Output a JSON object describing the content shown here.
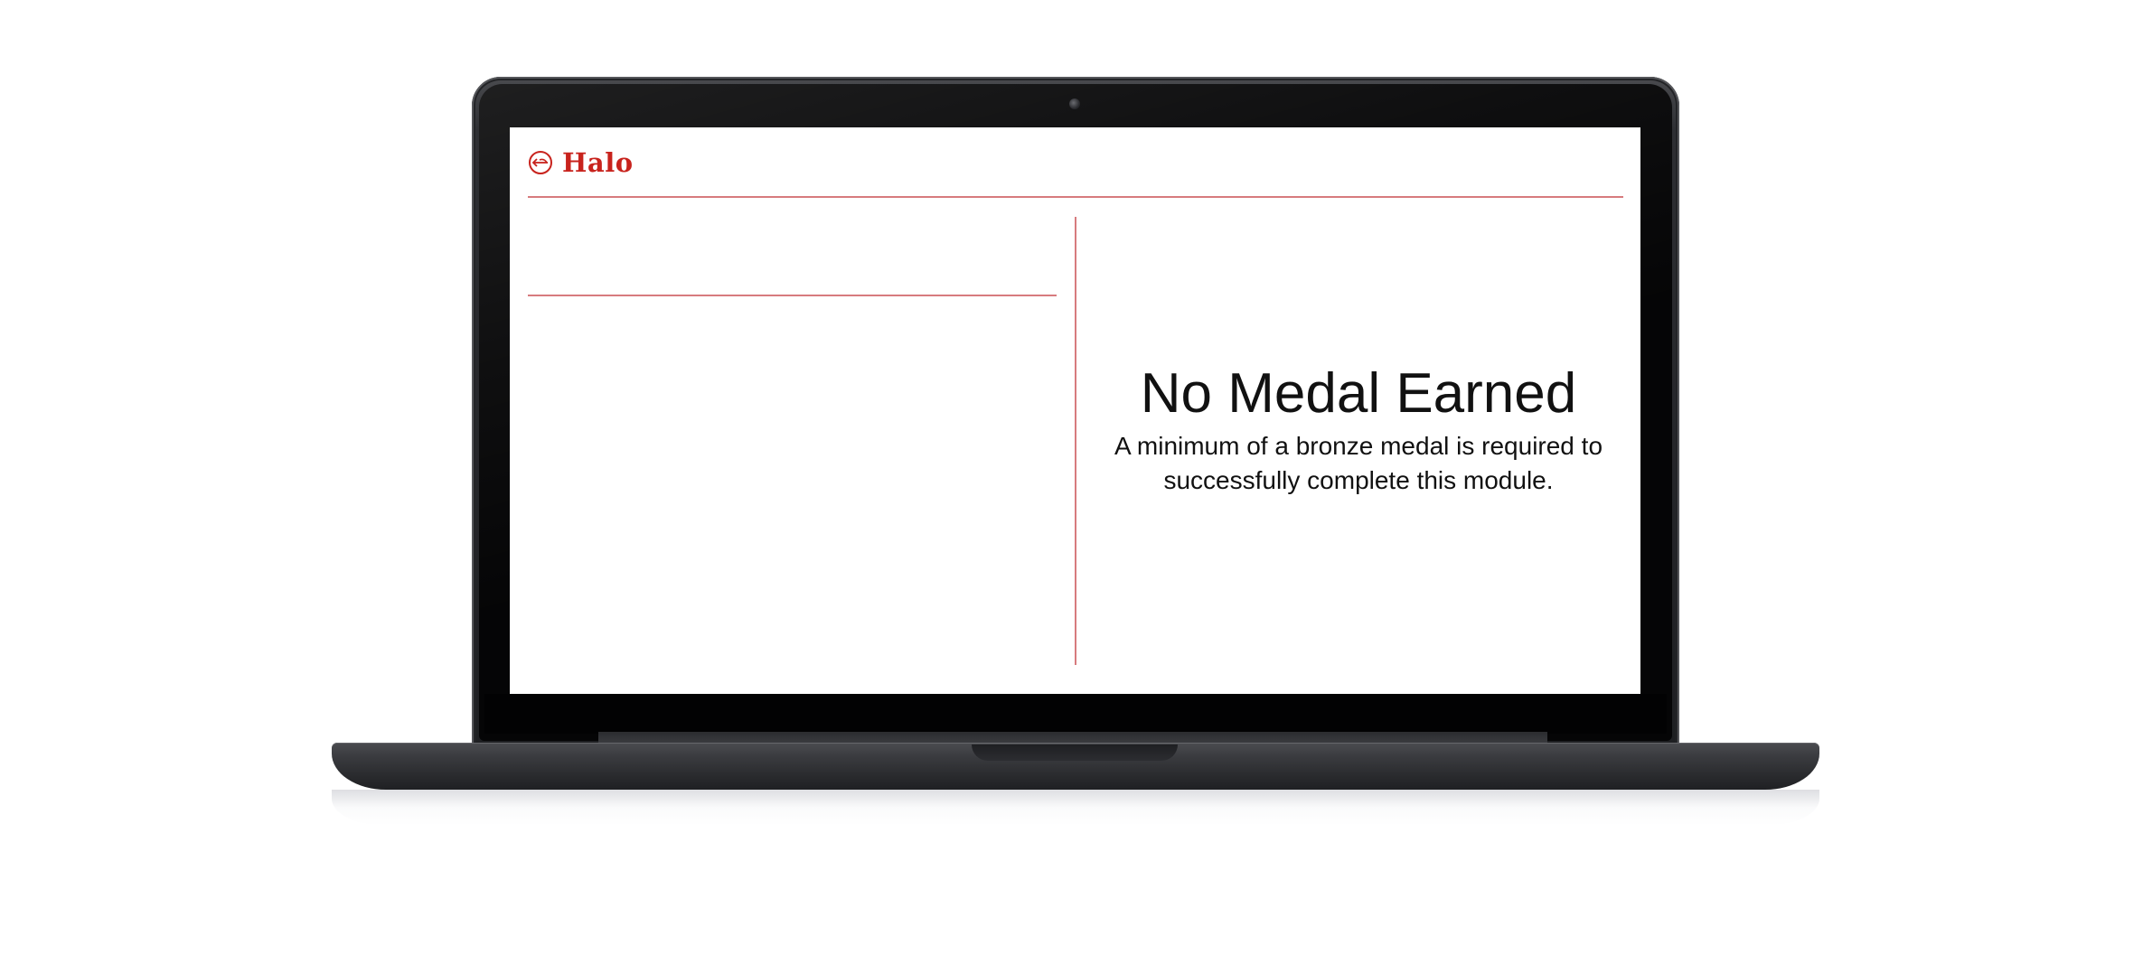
{
  "app": {
    "brand_name": "Halo",
    "brand_color": "#c8231d",
    "divider_color": "#d77b7e",
    "logo_icon": "halo-logo-icon"
  },
  "result": {
    "title": "No Medal Earned",
    "message": "A minimum of a bronze medal is required to successfully complete this module."
  }
}
